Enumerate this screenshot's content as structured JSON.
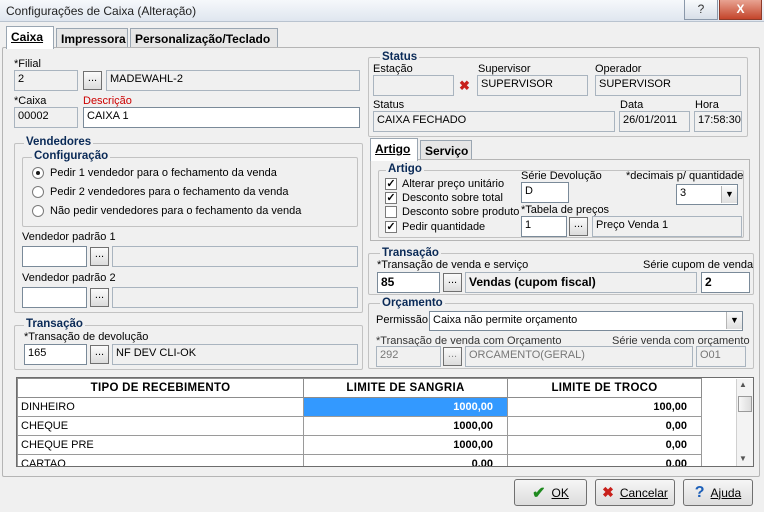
{
  "window": {
    "title": "Configurações de Caixa (Alteração)",
    "help_glyph": "?",
    "close_glyph": "X"
  },
  "tabs": [
    {
      "label": "Caixa"
    },
    {
      "label": "Impressora"
    },
    {
      "label": "Personalização/Teclado"
    }
  ],
  "filial": {
    "label": "*Filial",
    "value": "2",
    "name": "MADEWAHL-2",
    "button": "..."
  },
  "caixa": {
    "label": "*Caixa",
    "value": "00002"
  },
  "descricao": {
    "label": "Descrição",
    "value": "CAIXA 1"
  },
  "vendedores": {
    "title": "Vendedores",
    "config_title": "Configuração",
    "options": [
      "Pedir 1 vendedor para o fechamento da venda",
      "Pedir 2 vendedores para o fechamento da venda",
      "Não pedir vendedores para o fechamento da venda"
    ],
    "selected": 0,
    "padrao1_label": "Vendedor padrão 1",
    "padrao2_label": "Vendedor padrão 2",
    "button": "..."
  },
  "transacao_left": {
    "title": "Transação",
    "label": "*Transação de devolução",
    "value": "165",
    "name": "NF DEV CLI-OK",
    "button": "..."
  },
  "status": {
    "title": "Status",
    "estacao_label": "Estação",
    "estacao_value": "",
    "x_glyph": "✖",
    "supervisor_label": "Supervisor",
    "supervisor_value": "SUPERVISOR",
    "operador_label": "Operador",
    "operador_value": "SUPERVISOR",
    "status_label": "Status",
    "status_value": "CAIXA FECHADO",
    "data_label": "Data",
    "data_value": "26/01/2011",
    "hora_label": "Hora",
    "hora_value": "17:58:30"
  },
  "subtabs": [
    {
      "label": "Artigo"
    },
    {
      "label": "Serviço"
    }
  ],
  "artigo": {
    "title": "Artigo",
    "checks": [
      {
        "label": "Alterar preço unitário",
        "checked": true
      },
      {
        "label": "Desconto sobre total",
        "checked": true
      },
      {
        "label": "Desconto sobre produto",
        "checked": false
      },
      {
        "label": "Pedir quantidade",
        "checked": true
      }
    ],
    "check_glyph": "✓",
    "serie_dev_label": "Série Devolução",
    "serie_dev_value": "D",
    "decimais_label": "*decimais p/ quantidade",
    "decimais_value": "3",
    "tabela_label": "*Tabela de preços",
    "tabela_value": "1",
    "tabela_name": "Preço Venda 1",
    "button": "...",
    "arrow": "▼"
  },
  "transacao_right": {
    "title": "Transação",
    "label": "*Transação de venda e serviço",
    "value": "85",
    "name": "Vendas (cupom fiscal)",
    "serie_label": "Série cupom de venda",
    "serie_value": "2",
    "button": "..."
  },
  "orcamento": {
    "title": "Orçamento",
    "permissao_label": "Permissão:",
    "permissao_value": "Caixa não permite orçamento",
    "transacao_label": "*Transação de venda com Orçamento",
    "transacao_value": "292",
    "transacao_name": "ORCAMENTO(GERAL)",
    "serie_label": "Série venda com orçamento",
    "serie_value": "O01",
    "button": "...",
    "arrow": "▼"
  },
  "grid": {
    "headers": [
      "TIPO DE RECEBIMENTO",
      "LIMITE DE SANGRIA",
      "LIMITE DE TROCO"
    ],
    "rows": [
      [
        "DINHEIRO",
        "1000,00",
        "100,00"
      ],
      [
        "CHEQUE",
        "1000,00",
        "0,00"
      ],
      [
        "CHEQUE PRE",
        "1000,00",
        "0,00"
      ],
      [
        "CARTAO",
        "0,00",
        "0,00"
      ]
    ],
    "scroll_up": "▲",
    "scroll_down": "▼"
  },
  "buttons": {
    "ok": "OK",
    "cancel": "Cancelar",
    "help": "Ajuda",
    "ok_icon": "✔",
    "cancel_icon": "✖",
    "help_icon": "?"
  }
}
